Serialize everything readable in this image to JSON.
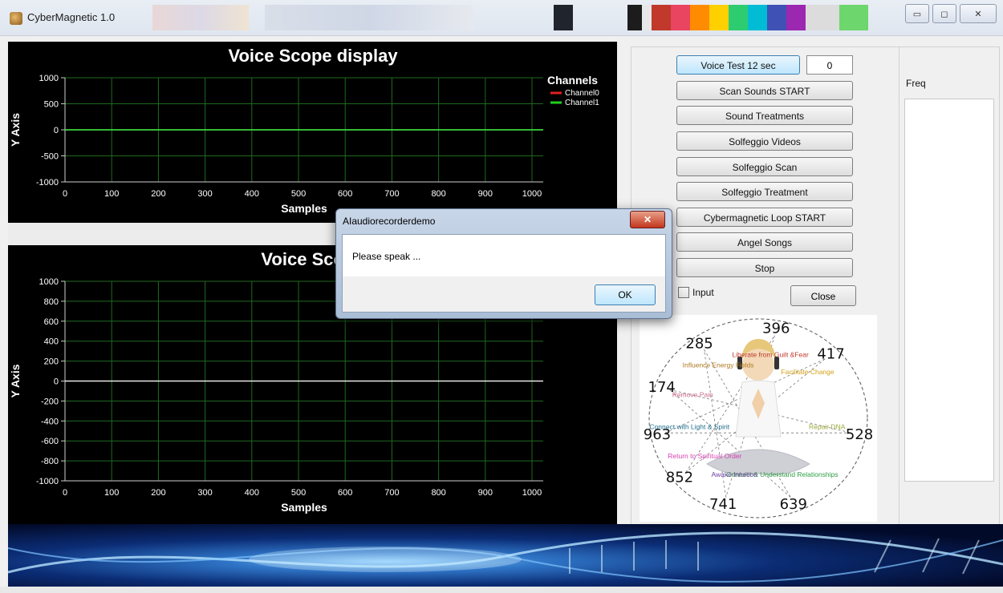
{
  "window": {
    "title": "CyberMagnetic 1.0",
    "controls": {
      "minimize": "▭",
      "maximize": "◻",
      "close": "✕"
    }
  },
  "scope_top": {
    "title": "Voice Scope display",
    "y_label": "Y Axis",
    "x_label": "Samples",
    "legend_title": "Channels",
    "legend": [
      {
        "name": "Channel0",
        "color": "#e02020"
      },
      {
        "name": "Channel1",
        "color": "#20d020"
      }
    ]
  },
  "scope_bottom": {
    "title": "Voice Scope",
    "y_label": "Y Axis",
    "x_label": "Samples"
  },
  "chart_data": [
    {
      "type": "line",
      "title": "Voice Scope display",
      "xlabel": "Samples",
      "ylabel": "Y Axis",
      "xlim": [
        0,
        1024
      ],
      "ylim": [
        -1000,
        1000
      ],
      "x_ticks": [
        0,
        100,
        200,
        300,
        400,
        500,
        600,
        700,
        800,
        900,
        1000
      ],
      "y_ticks": [
        1000,
        500,
        0,
        -500,
        -1000
      ],
      "grid": true,
      "legend_title": "Channels",
      "legend_placement": "right",
      "series": [
        {
          "name": "Channel0",
          "x": [
            0,
            1024
          ],
          "values": [
            0,
            0
          ],
          "color": "#e02020"
        },
        {
          "name": "Channel1",
          "x": [
            0,
            1024
          ],
          "values": [
            0,
            0
          ],
          "color": "#20d020"
        }
      ]
    },
    {
      "type": "line",
      "title": "Voice Scope",
      "xlabel": "Samples",
      "ylabel": "Y Axis",
      "xlim": [
        0,
        1024
      ],
      "ylim": [
        -1000,
        1000
      ],
      "x_ticks": [
        0,
        100,
        200,
        300,
        400,
        500,
        600,
        700,
        800,
        900,
        1000
      ],
      "y_ticks": [
        1000,
        800,
        600,
        400,
        200,
        0,
        -200,
        -400,
        -600,
        -800,
        -1000
      ],
      "grid": true,
      "series": [
        {
          "x": [
            0,
            1024
          ],
          "values": [
            0,
            0
          ],
          "color": "#e8e8e8"
        }
      ]
    }
  ],
  "controls": {
    "voice_test": "Voice Test 12 sec",
    "counter": "0",
    "buttons": [
      "Scan Sounds START",
      "Sound Treatments",
      "Solfeggio Videos",
      "Solfeggio Scan",
      "Solfeggio Treatment",
      "Cybermagnetic Loop START",
      "Angel Songs",
      "Stop"
    ],
    "input_label": "Input",
    "close_label": "Close"
  },
  "freq": {
    "label": "Freq"
  },
  "solfeggio": {
    "frequencies": [
      "396",
      "417",
      "528",
      "639",
      "741",
      "852",
      "963",
      "174",
      "285"
    ],
    "labels": [
      "Liberate from Guilt &Fear",
      "Facilitate Change",
      "Repair DNA",
      "Connect & Understand Relationships",
      "Awake Intuition",
      "Return to Spiritual Order",
      "Connect with Light & Spirit",
      "Remove Pain",
      "Influence Energy Fields"
    ],
    "colors": [
      "#c0392b",
      "#d4a017",
      "#9aa83a",
      "#2f9e44",
      "#6a3fa0",
      "#d63fb0",
      "#1f6e8c",
      "#c86b8a",
      "#b07a20"
    ]
  },
  "dialog": {
    "title": "AIaudiorecorderdemo",
    "message": "Please speak ...",
    "ok": "OK",
    "close": "✕"
  },
  "colors": {
    "scope_bg": "#000000",
    "grid": "#1f6a1f",
    "axis_text": "#ffffff",
    "zero_line": "#e8e8e8",
    "accent_button": "#bee6fd"
  }
}
